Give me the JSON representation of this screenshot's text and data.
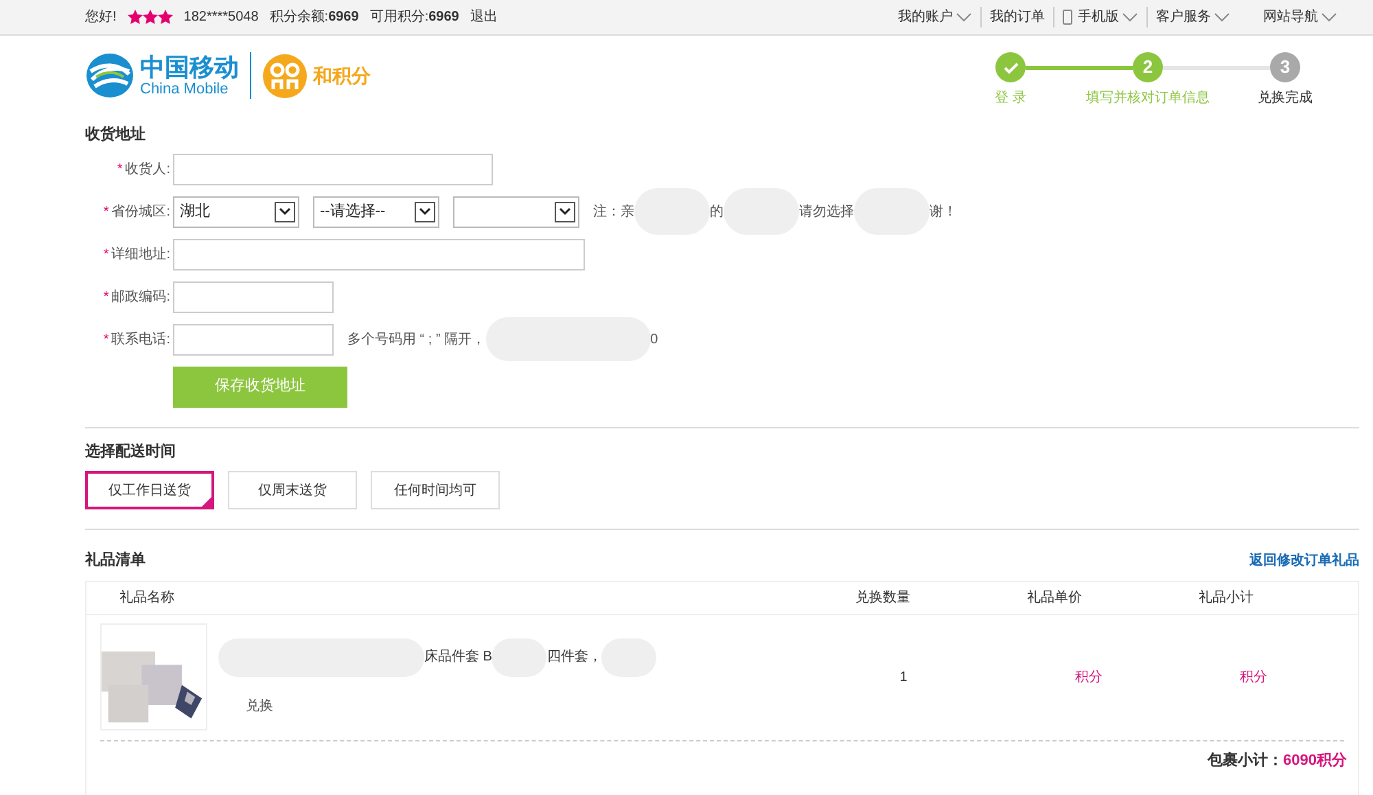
{
  "top_bar": {
    "greeting": "您好!",
    "stars": 3,
    "phone": "182****5048",
    "balance_label": "积分余额:",
    "balance": "6969",
    "available_label": "可用积分:",
    "available": "6969",
    "logout": "退出",
    "menus": [
      {
        "label": "我的账户",
        "dropdown": true,
        "phone_icon": false
      },
      {
        "label": "我的订单",
        "dropdown": false,
        "phone_icon": false
      },
      {
        "label": "手机版",
        "dropdown": true,
        "phone_icon": true
      },
      {
        "label": "客户服务",
        "dropdown": true,
        "phone_icon": false
      },
      {
        "label": "网站导航",
        "dropdown": true,
        "phone_icon": false
      }
    ]
  },
  "logo": {
    "cn": "中国移动",
    "en": "China Mobile",
    "badge": "和积分"
  },
  "steps": [
    {
      "label": "登 录",
      "done": true,
      "reached": true
    },
    {
      "label": "填写并核对订单信息",
      "done": false,
      "reached": true,
      "number": "2"
    },
    {
      "label": "兑换完成",
      "done": false,
      "reached": false,
      "number": "3"
    }
  ],
  "address": {
    "title": "收货地址",
    "required_mark": "*",
    "fields": [
      {
        "kind": "input",
        "label": "收货人:"
      },
      {
        "kind": "selects",
        "label": "省份城区:",
        "selects": [
          "湖北",
          "--请选择--"
        ],
        "blank_select": true,
        "note": [
          "注：亲",
          "的",
          "请勿选择",
          "谢！"
        ]
      },
      {
        "kind": "input",
        "label": "详细地址:"
      },
      {
        "kind": "input",
        "label": "邮政编码:"
      },
      {
        "kind": "input",
        "label": "联系电话:",
        "hint": [
          "多个号码用 “ ; ” 隔开，",
          "0"
        ]
      }
    ],
    "save_button": "保存收货地址"
  },
  "delivery": {
    "title": "选择配送时间",
    "options": [
      {
        "label": "仅工作日送货",
        "selected": true
      },
      {
        "label": "仅周末送货",
        "selected": false
      },
      {
        "label": "任何时间均可",
        "selected": false
      }
    ]
  },
  "gifts": {
    "title": "礼品清单",
    "back_link": "返回修改订单礼品",
    "columns": [
      "礼品名称",
      "兑换数量",
      "礼品单价",
      "礼品小计"
    ],
    "rows": [
      {
        "name": [
          "床品件套 B",
          "四件套，"
        ],
        "action": "兑换",
        "quantity": "1",
        "unit_price": "积分",
        "subtotal": "积分"
      }
    ],
    "package_label": "包裹小计：",
    "package_total": "6090积分"
  }
}
